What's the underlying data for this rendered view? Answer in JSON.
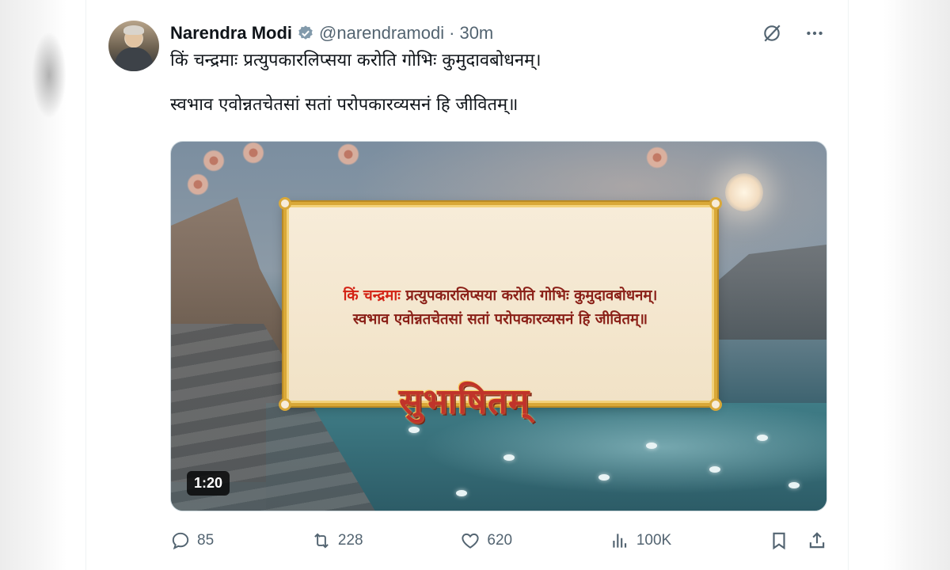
{
  "author": {
    "name": "Narendra Modi",
    "handle": "@narendramodi",
    "separator": "·",
    "time": "30m"
  },
  "tweet": {
    "line1": "किं चन्द्रमाः प्रत्युपकारलिप्सया करोति गोभिः कुमुदावबोधनम्।",
    "line2": "स्वभाव एवोन्नतचेतसां सतां परोपकारव्यसनं हि जीवितम्॥"
  },
  "media": {
    "scroll_line1_highlight": "किं चन्द्रमाः",
    "scroll_line1_rest": " प्रत्युपकारलिप्सया करोति गोभिः कुमुदावबोधनम्।",
    "scroll_line2": "स्वभाव एवोन्नतचेतसां सतां परोपकारव्यसनं हि जीवितम्॥",
    "title": "सुभाषितम्",
    "duration": "1:20"
  },
  "actions": {
    "replies": "85",
    "reposts": "228",
    "likes": "620",
    "views": "100K"
  },
  "icons": {
    "verified": "verified-badge-icon",
    "grok": "grok-icon",
    "more": "more-icon",
    "reply": "reply-icon",
    "repost": "repost-icon",
    "like": "like-icon",
    "views": "views-icon",
    "bookmark": "bookmark-icon",
    "share": "share-icon"
  },
  "colors": {
    "verified": "#829aab",
    "text": "#0f1419",
    "muted": "#536471",
    "scroll_text": "#8a1f17",
    "scroll_highlight": "#d32214"
  }
}
